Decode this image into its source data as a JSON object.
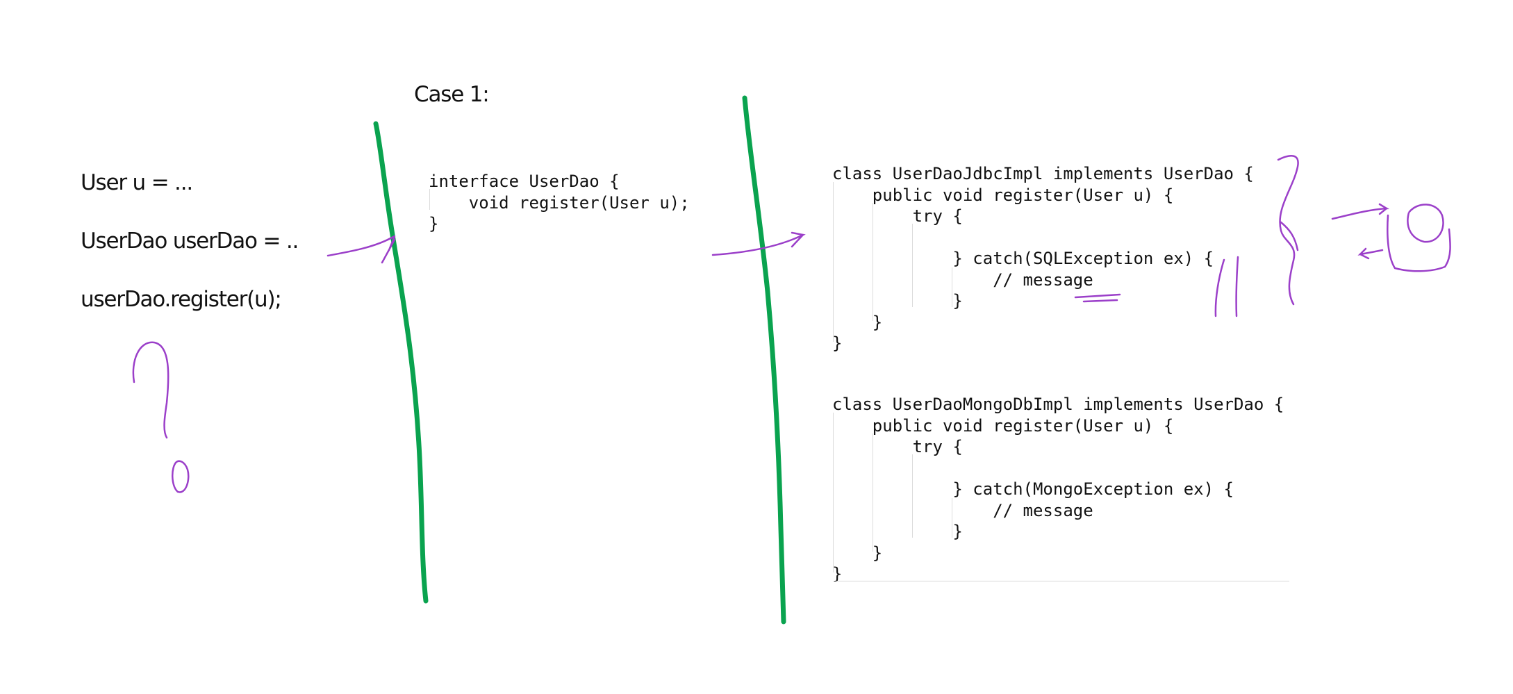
{
  "left_notes": [
    "User u = ...",
    "UserDao userDao = ..",
    "userDao.register(u);"
  ],
  "case_label": "Case 1:",
  "interface_code": [
    "interface UserDao {",
    "    void register(User u);",
    "}"
  ],
  "jdbc_code": [
    "class UserDaoJdbcImpl implements UserDao {",
    "    public void register(User u) {",
    "        try {",
    "",
    "            } catch(SQLException ex) {",
    "                // message",
    "            }",
    "    }",
    "}"
  ],
  "mongo_code": [
    "class UserDaoMongoDbImpl implements UserDao {",
    "    public void register(User u) {",
    "        try {",
    "",
    "            } catch(MongoException ex) {",
    "                // message",
    "            }",
    "    }",
    "}"
  ],
  "colors": {
    "divider_green": "#0aa34f",
    "annotation_purple": "#9b3fc9",
    "text": "#111111"
  },
  "drawings": [
    "question-mark-sketch",
    "arrow-sketch",
    "braces-sketch",
    "circle-sketch"
  ]
}
